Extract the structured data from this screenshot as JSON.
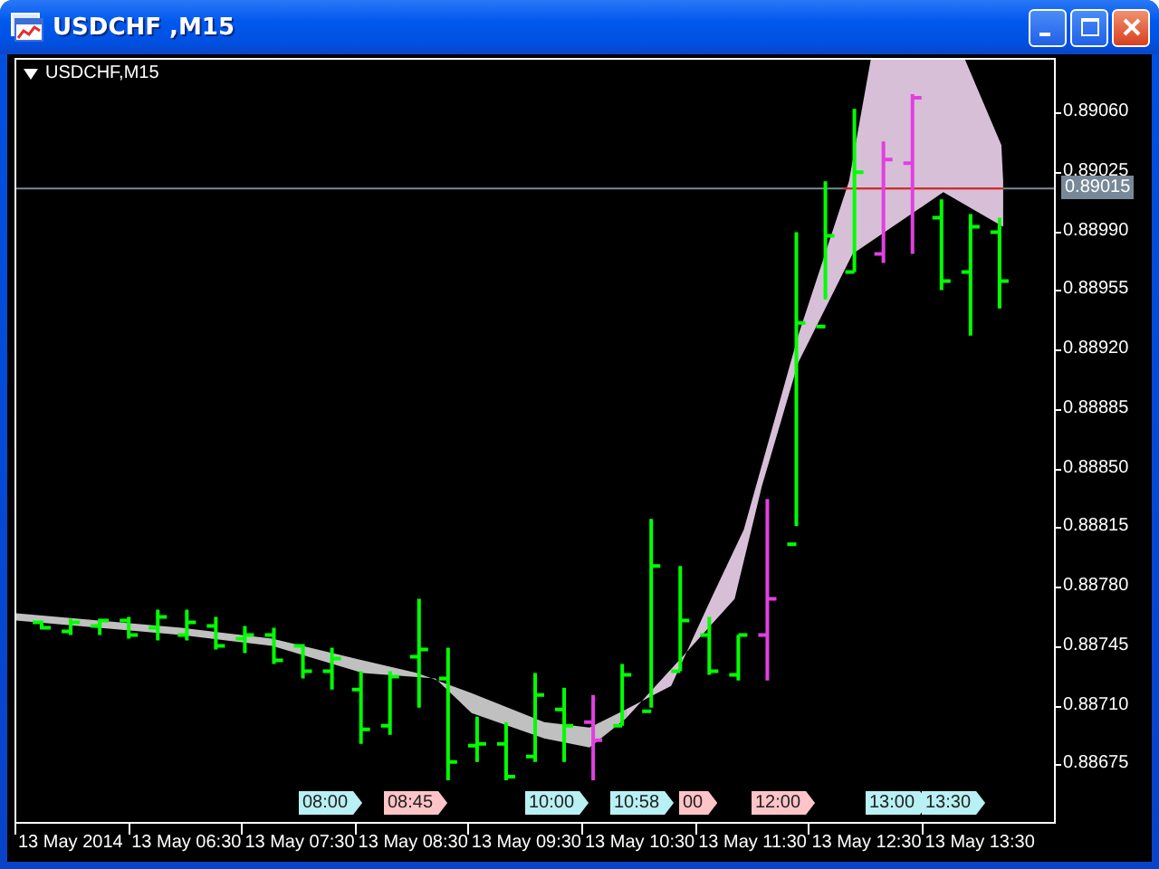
{
  "window": {
    "title": "USDCHF ,M15"
  },
  "chart": {
    "label": "USDCHF,M15",
    "price_axis": [
      "0.89060",
      "0.89025",
      "0.88990",
      "0.88955",
      "0.88920",
      "0.88885",
      "0.88850",
      "0.88815",
      "0.88780",
      "0.88745",
      "0.88710",
      "0.88675"
    ],
    "current_price": "0.89015",
    "time_axis": [
      "13 May 2014",
      "13 May 06:30",
      "13 May 07:30",
      "13 May 08:30",
      "13 May 09:30",
      "13 May 10:30",
      "13 May 11:30",
      "13 May 12:30",
      "13 May 13:30"
    ],
    "event_tags": [
      {
        "label": "08:00",
        "color": "#b8f0f4"
      },
      {
        "label": "08:45",
        "color": "#ffc4c8"
      },
      {
        "label": "10:00",
        "color": "#b8f0f4"
      },
      {
        "label": "10:58",
        "color": "#b8f0f4"
      },
      {
        "label": "00",
        "color": "#ffc4c8"
      },
      {
        "label": "12:00",
        "color": "#ffc4c8"
      },
      {
        "label": "13:00",
        "color": "#b8f0f4"
      },
      {
        "label": "13:30",
        "color": "#b8f0f4"
      }
    ]
  }
}
